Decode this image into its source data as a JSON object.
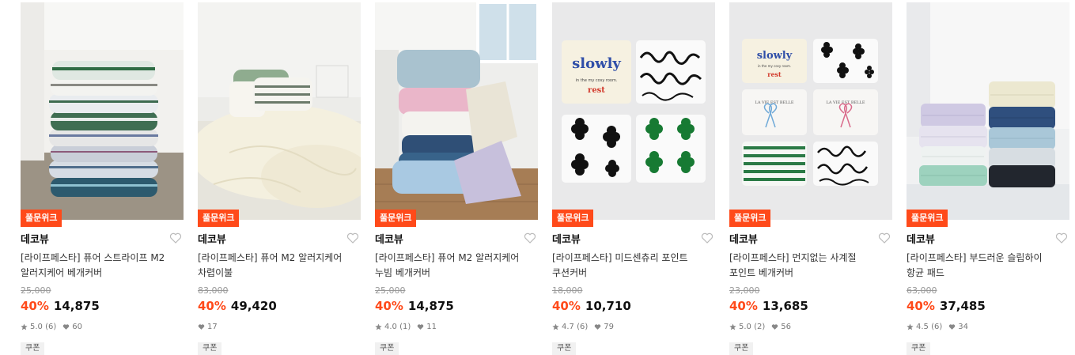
{
  "products": [
    {
      "badge": "풀문위크",
      "brand": "데코뷰",
      "title_line1": "[라이프페스타] 퓨어 스트라이프 M2",
      "title_line2": "알러지케어 베개커버",
      "original_price": "25,000",
      "discount": "40%",
      "price": "14,875",
      "rating": "5.0 (6)",
      "likes": "60",
      "coupon": "쿠폰",
      "image": "striped-pillow-stack"
    },
    {
      "badge": "풀문위크",
      "brand": "데코뷰",
      "title_line1": "[라이프페스타] 퓨어 M2 알러지케어",
      "title_line2": "차렵이불",
      "original_price": "83,000",
      "discount": "40%",
      "price": "49,420",
      "rating": "",
      "likes": "17",
      "coupon": "쿠폰",
      "image": "cream-comforter-bed"
    },
    {
      "badge": "풀문위크",
      "brand": "데코뷰",
      "title_line1": "[라이프페스타] 퓨어 M2 알러지케어",
      "title_line2": "누빔 베개커버",
      "original_price": "25,000",
      "discount": "40%",
      "price": "14,875",
      "rating": "4.0 (1)",
      "likes": "11",
      "coupon": "쿠폰",
      "image": "pastel-pillows-corner"
    },
    {
      "badge": "풀문위크",
      "brand": "데코뷰",
      "title_line1": "[라이프페스타] 미드센츄리 포인트",
      "title_line2": "쿠션커버",
      "original_price": "18,000",
      "discount": "40%",
      "price": "10,710",
      "rating": "4.7 (6)",
      "likes": "79",
      "coupon": "쿠폰",
      "image": "print-cushion-grid"
    },
    {
      "badge": "풀문위크",
      "brand": "데코뷰",
      "title_line1": "[라이프페스타] 먼지없는 사계절",
      "title_line2": "포인트 베개커버",
      "original_price": "23,000",
      "discount": "40%",
      "price": "13,685",
      "rating": "5.0 (2)",
      "likes": "56",
      "coupon": "쿠폰",
      "image": "print-pillowcase-grid"
    },
    {
      "badge": "풀문위크",
      "brand": "데코뷰",
      "title_line1": "[라이프페스타] 부드러운 슬립하이",
      "title_line2": "항균 패드",
      "original_price": "63,000",
      "discount": "40%",
      "price": "37,485",
      "rating": "4.5 (6)",
      "likes": "34",
      "coupon": "쿠폰",
      "image": "quilted-pad-stacks"
    }
  ],
  "images": {
    "card3_text": {
      "slowly": "slowly",
      "subtitle": "in the my cosy room.",
      "rest": "rest"
    },
    "card4_text": {
      "slowly": "slowly",
      "subtitle": "in the my cosy room.",
      "rest": "rest",
      "lavie": "LA VIE EST BELLE"
    }
  },
  "colors": {
    "accent": "#ff4a1a",
    "heart": "#bbbbbb"
  }
}
